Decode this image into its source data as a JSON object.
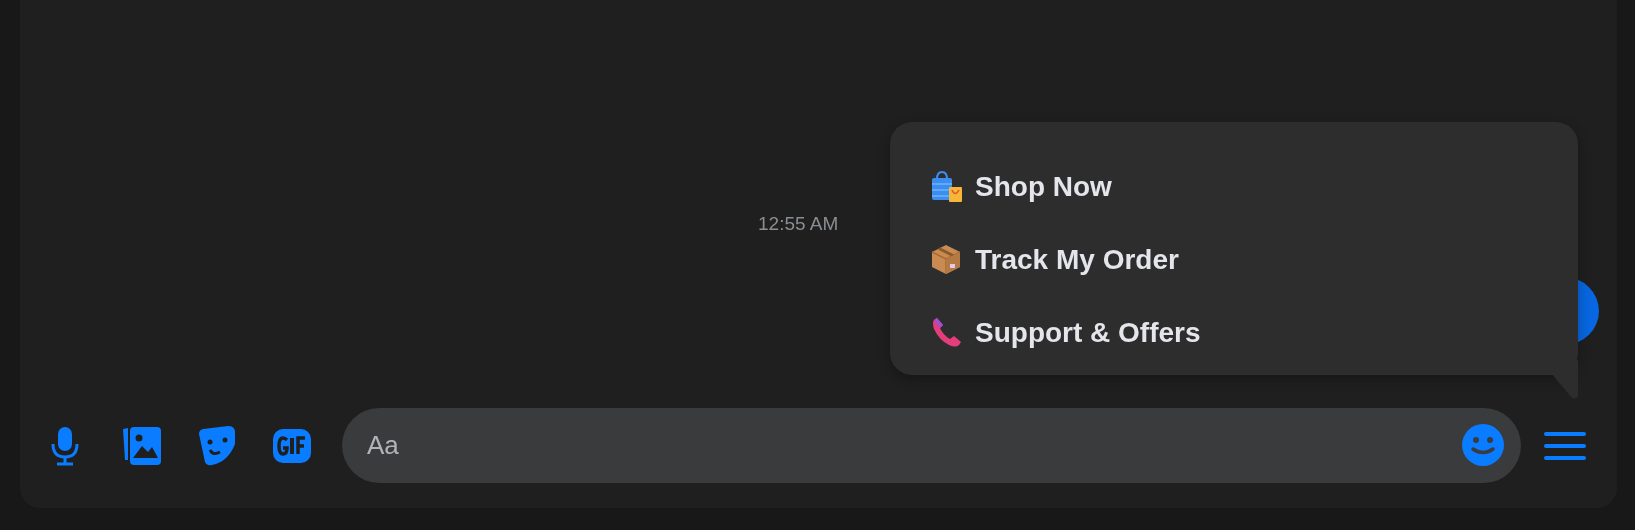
{
  "timestamp": "12:55 AM",
  "quick_replies": [
    {
      "label": "Shop Now"
    },
    {
      "label": "Track My Order"
    },
    {
      "label": "Support & Offers"
    }
  ],
  "composer": {
    "placeholder": "Aa"
  }
}
